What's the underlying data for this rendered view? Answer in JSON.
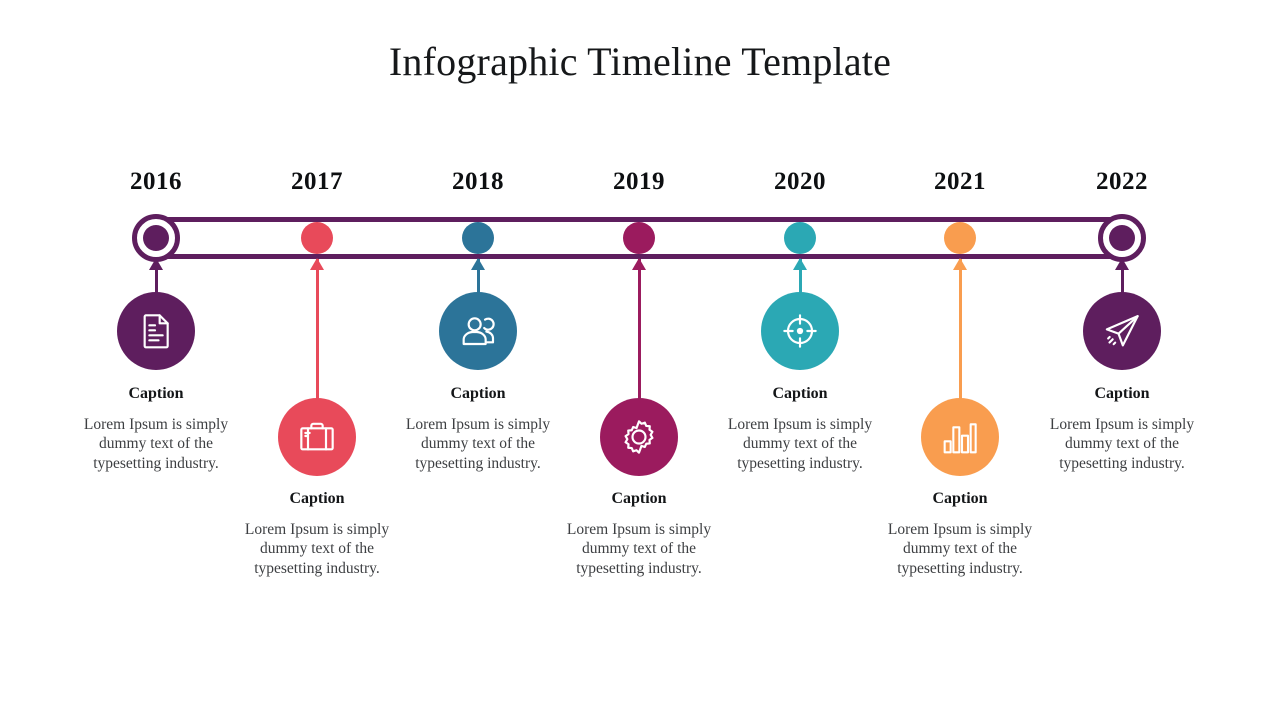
{
  "title": "Infographic Timeline Template",
  "theme": {
    "background": "#ffffff",
    "bar_color": "#5E1E5E",
    "title_color": "#16181a",
    "caption_title_color": "#141618",
    "caption_body_color": "#3d3f42"
  },
  "timeline": {
    "bar_shape": "rounded-rectangle-outline",
    "endpoint_marker": "ring-with-filled-center",
    "nodes": [
      {
        "year": "2016",
        "color": "#5E1E5E",
        "icon": "document-icon",
        "position": "above",
        "endpoint": true,
        "caption_title": "Caption",
        "caption_body": "Lorem Ipsum is simply dummy text of the typesetting industry."
      },
      {
        "year": "2017",
        "color": "#E84A5A",
        "icon": "briefcase-icon",
        "position": "below",
        "endpoint": false,
        "caption_title": "Caption",
        "caption_body": "Lorem Ipsum is simply dummy text of the typesetting industry."
      },
      {
        "year": "2018",
        "color": "#2C7499",
        "icon": "users-icon",
        "position": "above",
        "endpoint": false,
        "caption_title": "Caption",
        "caption_body": "Lorem Ipsum is simply dummy text of the typesetting industry."
      },
      {
        "year": "2019",
        "color": "#9B1B5E",
        "icon": "gear-icon",
        "position": "below",
        "endpoint": false,
        "caption_title": "Caption",
        "caption_body": "Lorem Ipsum is simply dummy text of the typesetting industry."
      },
      {
        "year": "2020",
        "color": "#2BA8B4",
        "icon": "target-icon",
        "position": "above",
        "endpoint": false,
        "caption_title": "Caption",
        "caption_body": "Lorem Ipsum is simply dummy text of the typesetting industry."
      },
      {
        "year": "2021",
        "color": "#F99D4F",
        "icon": "bar-chart-icon",
        "position": "below",
        "endpoint": false,
        "caption_title": "Caption",
        "caption_body": "Lorem Ipsum is simply dummy text of the typesetting industry."
      },
      {
        "year": "2022",
        "color": "#5E1E5E",
        "icon": "paper-plane-icon",
        "position": "above",
        "endpoint": true,
        "caption_title": "Caption",
        "caption_body": "Lorem Ipsum is simply dummy text of the typesetting industry."
      }
    ]
  }
}
